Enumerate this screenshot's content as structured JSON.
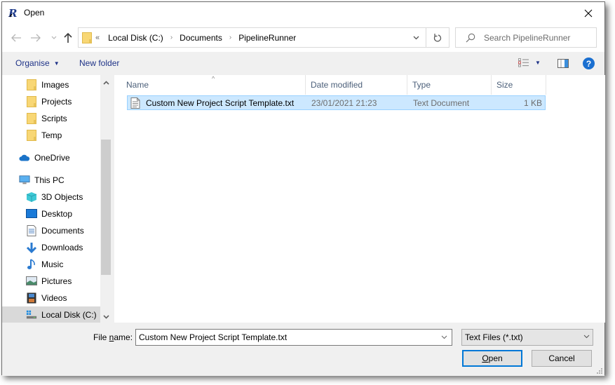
{
  "window": {
    "title": "Open",
    "app_icon": "app-logo-icon"
  },
  "nav": {
    "back_icon": "arrow-left-icon",
    "forward_icon": "arrow-right-icon",
    "recent_icon": "chevron-down-icon",
    "up_icon": "arrow-up-icon",
    "breadcrumb_overflow": "«",
    "breadcrumbs": [
      "Local Disk (C:)",
      "Documents",
      "PipelineRunner"
    ],
    "search_placeholder": "Search PipelineRunner"
  },
  "toolbar": {
    "organise_label": "Organise",
    "new_folder_label": "New folder"
  },
  "sidebar": {
    "items": [
      {
        "label": "Images",
        "icon": "folder-icon",
        "indent": 1
      },
      {
        "label": "Projects",
        "icon": "folder-icon",
        "indent": 1
      },
      {
        "label": "Scripts",
        "icon": "folder-icon",
        "indent": 1
      },
      {
        "label": "Temp",
        "icon": "folder-icon",
        "indent": 1
      },
      {
        "label": "OneDrive",
        "icon": "cloud-icon",
        "indent": 0
      },
      {
        "label": "This PC",
        "icon": "computer-icon",
        "indent": 0
      },
      {
        "label": "3D Objects",
        "icon": "cube-icon",
        "indent": 1
      },
      {
        "label": "Desktop",
        "icon": "desktop-icon",
        "indent": 1
      },
      {
        "label": "Documents",
        "icon": "document-icon",
        "indent": 1
      },
      {
        "label": "Downloads",
        "icon": "download-icon",
        "indent": 1
      },
      {
        "label": "Music",
        "icon": "music-icon",
        "indent": 1
      },
      {
        "label": "Pictures",
        "icon": "picture-icon",
        "indent": 1
      },
      {
        "label": "Videos",
        "icon": "video-icon",
        "indent": 1
      },
      {
        "label": "Local Disk (C:)",
        "icon": "drive-icon",
        "indent": 1,
        "selected": true
      }
    ]
  },
  "filelist": {
    "columns": [
      "Name",
      "Date modified",
      "Type",
      "Size"
    ],
    "sorted_column": "Name",
    "rows": [
      {
        "name": "Custom New Project Script Template.txt",
        "date_modified": "23/01/2021 21:23",
        "type": "Text Document",
        "size": "1 KB",
        "selected": true
      }
    ]
  },
  "footer": {
    "file_name_label_prefix": "File ",
    "file_name_label_mnemonic": "n",
    "file_name_label_suffix": "ame:",
    "file_name_value": "Custom New Project Script Template.txt",
    "file_type_selected": "Text Files (*.txt)",
    "open_mnemonic": "O",
    "open_rest": "pen",
    "cancel_label": "Cancel"
  },
  "colors": {
    "accent": "#0078d7",
    "selection_bg": "#cce8ff",
    "selection_border": "#99d1ff",
    "link_text": "#1e3287",
    "help_blue": "#1a6fd0",
    "folder_yellow": "#f8d775"
  }
}
